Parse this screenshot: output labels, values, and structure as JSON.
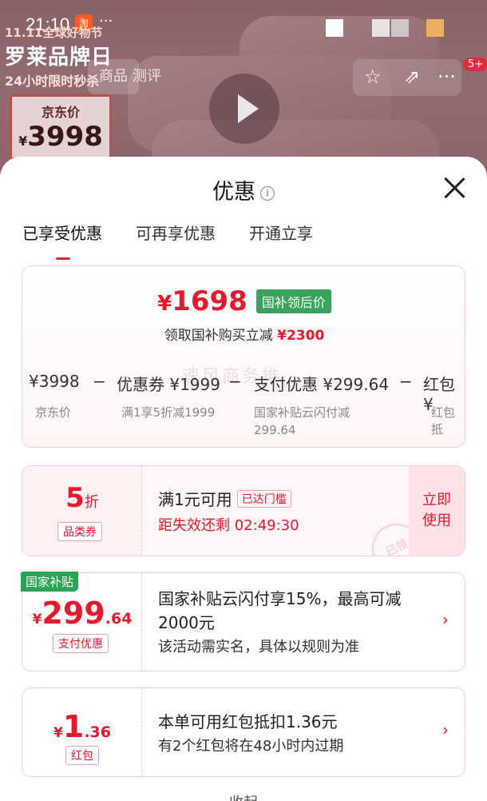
{
  "status": {
    "time": "21:10",
    "app_badge": "淘",
    "more": "···"
  },
  "banner": {
    "line1": "11.11全球好物节",
    "line2": "罗莱品牌日",
    "line3": "24小时限时秒杀"
  },
  "price_card": {
    "label": "京东价",
    "currency": "¥",
    "amount": "3998"
  },
  "top_tabs": {
    "goods": "商品",
    "review": "测评"
  },
  "top_badge": "5+",
  "sheet": {
    "title": "优惠",
    "tabs": [
      "已享受优惠",
      "可再享优惠",
      "开通立享"
    ]
  },
  "summary": {
    "currency": "¥",
    "final_price": "1698",
    "tag": "国补领后价",
    "subtitle": "领取国补购买立减",
    "saving": "¥2300",
    "watermark": "速风商务推",
    "breakdown": [
      {
        "value": "¥3998",
        "label": "京东价"
      },
      {
        "value": "优惠券 ¥1999",
        "label": "满1享5折减1999"
      },
      {
        "value": "支付优惠 ¥299.64",
        "label": "国家补贴云闪付减299.64"
      },
      {
        "value": "红包 ¥",
        "label": "红包抵"
      }
    ],
    "minus": "−"
  },
  "coupon": {
    "discount": "5",
    "discount_unit": "折",
    "type": "品类券",
    "condition": "满1元可用",
    "status": "已达门槛",
    "countdown": "距失效还剩 02:49:30",
    "action_line1": "立即",
    "action_line2": "使用",
    "stamp": "已领"
  },
  "subsidy": {
    "corner_tag": "国家补贴",
    "currency": "¥",
    "int": "299",
    "dec": ".64",
    "type": "支付优惠",
    "line1": "国家补贴云闪付享15%，最高可减",
    "line2": "2000元",
    "note": "该活动需实名，具体以规则为准",
    "arrow": "›"
  },
  "redpacket": {
    "currency": "¥",
    "int": "1",
    "dec": ".36",
    "type": "红包",
    "line1": "本单可用红包抵扣1.36元",
    "line2": "有2个红包将在48小时内过期",
    "arrow": "›"
  },
  "collapse": "收起"
}
